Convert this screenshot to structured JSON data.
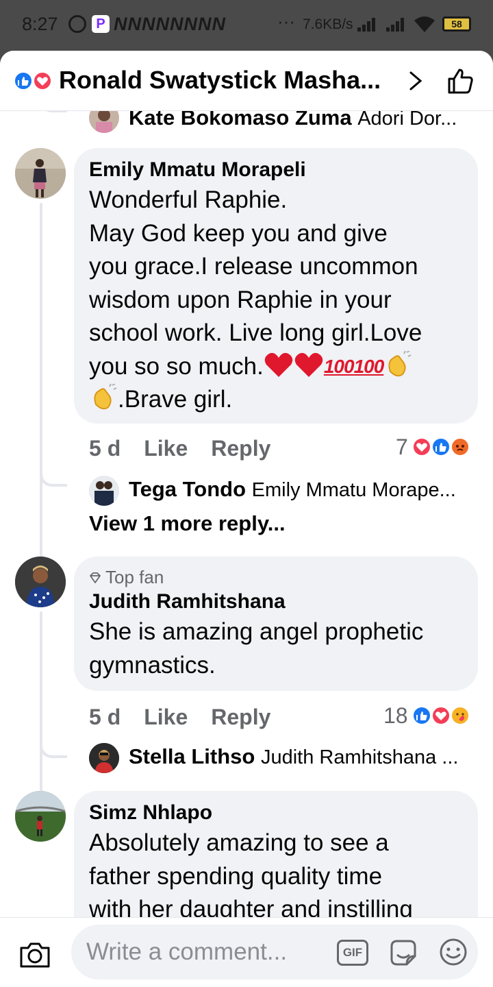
{
  "status_bar": {
    "time": "8:27",
    "notif_letters": "NNNNNNNN",
    "more": "···",
    "speed": "7.6KB/s",
    "battery": "58"
  },
  "header": {
    "title": "Ronald Swatystick Masha..."
  },
  "comments": [
    {
      "reply_preview": {
        "name": "Kate Bokomaso Zuma",
        "text": "Adori Dor..."
      }
    },
    {
      "name": "Emily Mmatu Morapeli",
      "lines": [
        "Wonderful  Raphie.",
        "May God keep  you and give",
        "you grace.I release uncommon",
        "wisdom upon Raphie in your",
        "school  work. Live long girl.Love"
      ],
      "line6_text": "you so so much.",
      "emoji_100": "100",
      "line7_text": ".Brave girl.",
      "age": "5 d",
      "like": "Like",
      "reply": "Reply",
      "reaction_count": "7",
      "reply_preview": {
        "name": "Tega Tondo",
        "text": "Emily Mmatu Morape..."
      },
      "view_more": "View 1 more reply..."
    },
    {
      "badge": "Top fan",
      "name": "Judith Ramhitshana",
      "lines": [
        "She is amazing angel prophetic",
        "gymnastics."
      ],
      "age": "5 d",
      "like": "Like",
      "reply": "Reply",
      "reaction_count": "18",
      "reply_preview": {
        "name": "Stella Lithso",
        "text": "Judith Ramhitshana ..."
      }
    },
    {
      "name": "Simz Nhlapo",
      "lines": [
        "Absolutely amazing to see a",
        "father spending quality time",
        "with her daughter and instilling"
      ]
    }
  ],
  "composer": {
    "placeholder": "Write a comment...",
    "gif_label": "GIF"
  },
  "colors": {
    "like_blue": "#1877f2",
    "love_red": "#f33e58",
    "bubble": "#f0f2f5",
    "muted_text": "#65676b"
  }
}
